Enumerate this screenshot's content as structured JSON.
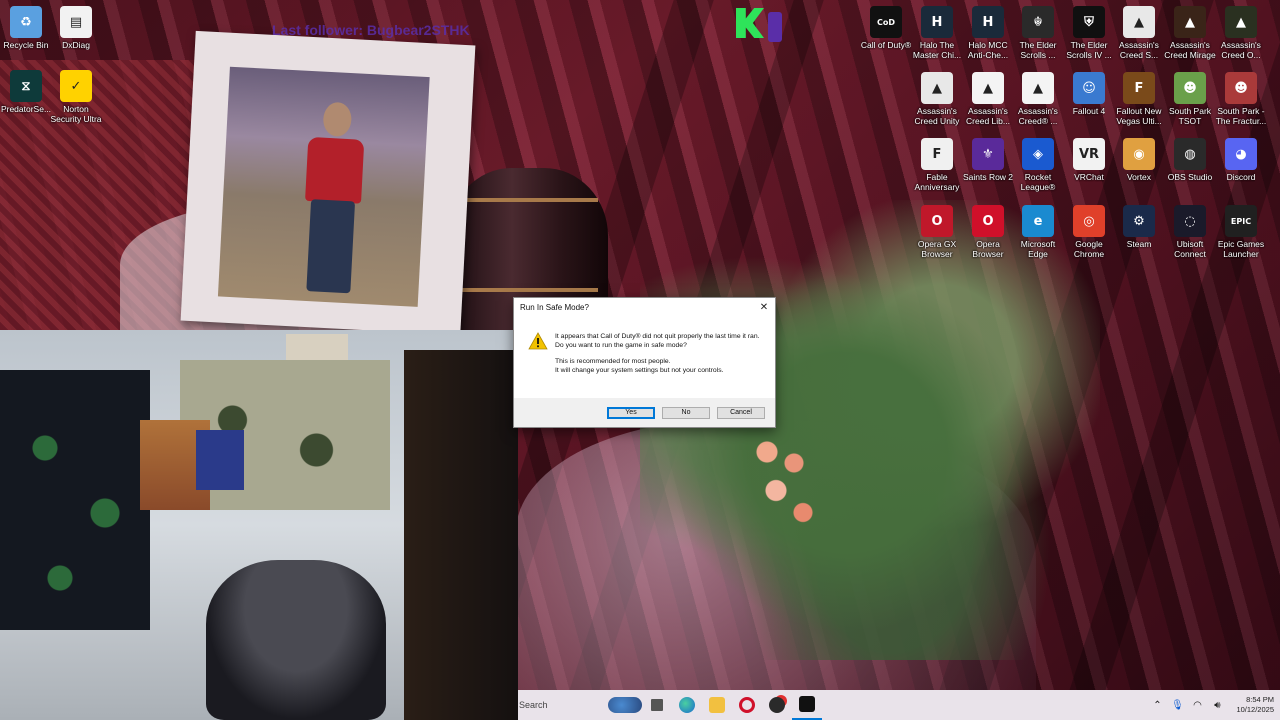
{
  "overlay": {
    "stream_text": "Last follower: Bugbear2STHK"
  },
  "desktop_icons": [
    {
      "label": "Recycle Bin",
      "name": "recycle-bin-icon",
      "glyph": "♻",
      "bg": "#5aa0e0"
    },
    {
      "label": "DxDiag",
      "name": "dxdiag-icon",
      "glyph": "▤",
      "bg": "#f2f2f2"
    },
    {
      "label": "PredatorSe...",
      "name": "predatorsense-icon",
      "glyph": "⧖",
      "bg": "#0e3a3a"
    },
    {
      "label": "Norton Security Ultra",
      "name": "norton-icon",
      "glyph": "✓",
      "bg": "#ffd200"
    },
    {
      "label": "Call of Duty®",
      "name": "call-of-duty-icon",
      "glyph": "CoD",
      "bg": "#111111"
    },
    {
      "label": "Halo The Master Chi...",
      "name": "halo-mcc-icon",
      "glyph": "H",
      "bg": "#1a2a3a"
    },
    {
      "label": "Halo MCC Anti-Che...",
      "name": "halo-anticheat-icon",
      "glyph": "H",
      "bg": "#1a2a3a"
    },
    {
      "label": "The Elder Scrolls ...",
      "name": "elder-scrolls-v-icon",
      "glyph": "☬",
      "bg": "#2a2a2a"
    },
    {
      "label": "The Elder Scrolls IV ...",
      "name": "elder-scrolls-iv-icon",
      "glyph": "⛨",
      "bg": "#101010"
    },
    {
      "label": "Assassin's Creed S...",
      "name": "ac-syndicate-icon",
      "glyph": "▲",
      "bg": "#e8e8e8"
    },
    {
      "label": "Assassin's Creed Mirage",
      "name": "ac-mirage-icon",
      "glyph": "▲",
      "bg": "#3a2418"
    },
    {
      "label": "Assassin's Creed O...",
      "name": "ac-origins-icon",
      "glyph": "▲",
      "bg": "#2a3020"
    },
    {
      "label": "Assassin's Creed Unity",
      "name": "ac-unity-icon",
      "glyph": "▲",
      "bg": "#e8e8e8"
    },
    {
      "label": "Assassin's Creed Lib...",
      "name": "ac-liberation-icon",
      "glyph": "▲",
      "bg": "#f4f4f4"
    },
    {
      "label": "Assassin's Creed® ...",
      "name": "ac-other-icon",
      "glyph": "▲",
      "bg": "#f4f4f4"
    },
    {
      "label": "Fallout 4",
      "name": "fallout-4-icon",
      "glyph": "☺",
      "bg": "#3a7ad0"
    },
    {
      "label": "Fallout New Vegas Ulti...",
      "name": "fallout-nv-icon",
      "glyph": "F",
      "bg": "#7a4a1a"
    },
    {
      "label": "South Park TSOT",
      "name": "south-park-tsot-icon",
      "glyph": "☻",
      "bg": "#6aa04a"
    },
    {
      "label": "South Park - The Fractur...",
      "name": "south-park-fbw-icon",
      "glyph": "☻",
      "bg": "#aa3a3a"
    },
    {
      "label": "Fable Anniversary",
      "name": "fable-icon",
      "glyph": "F",
      "bg": "#f0f0f0"
    },
    {
      "label": "Saints Row 2",
      "name": "saints-row-2-icon",
      "glyph": "⚜",
      "bg": "#5a2a9a"
    },
    {
      "label": "Rocket League®",
      "name": "rocket-league-icon",
      "glyph": "◈",
      "bg": "#1a5ad0"
    },
    {
      "label": "VRChat",
      "name": "vrchat-icon",
      "glyph": "VR",
      "bg": "#f2f2f2"
    },
    {
      "label": "Vortex",
      "name": "vortex-icon",
      "glyph": "◉",
      "bg": "#e0a040"
    },
    {
      "label": "OBS Studio",
      "name": "obs-studio-icon",
      "glyph": "◍",
      "bg": "#2a2a2a"
    },
    {
      "label": "Discord",
      "name": "discord-icon",
      "glyph": "◕",
      "bg": "#5865f2"
    },
    {
      "label": "Opera GX Browser",
      "name": "opera-gx-icon",
      "glyph": "O",
      "bg": "#c0182a"
    },
    {
      "label": "Opera Browser",
      "name": "opera-icon",
      "glyph": "O",
      "bg": "#d0102a"
    },
    {
      "label": "Microsoft Edge",
      "name": "microsoft-edge-icon",
      "glyph": "e",
      "bg": "#1a8ad0"
    },
    {
      "label": "Google Chrome",
      "name": "google-chrome-icon",
      "glyph": "◎",
      "bg": "#e0402a"
    },
    {
      "label": "Steam",
      "name": "steam-icon",
      "glyph": "⚙",
      "bg": "#1a2a4a"
    },
    {
      "label": "Ubisoft Connect",
      "name": "ubisoft-connect-icon",
      "glyph": "◌",
      "bg": "#1a1a2a"
    },
    {
      "label": "Epic Games Launcher",
      "name": "epic-games-icon",
      "glyph": "EPIC",
      "bg": "#202020"
    }
  ],
  "dialog": {
    "title": "Run In Safe Mode?",
    "line1": "It appears that Call of Duty® did not quit properly the last time it ran.",
    "line2": "Do you want to run the game in safe mode?",
    "line3": "This is recommended for most people.",
    "line4": "It will change your system settings but not your controls.",
    "yes": "Yes",
    "no": "No",
    "cancel": "Cancel"
  },
  "taskbar": {
    "search_placeholder": "Search",
    "time": "8:54 PM",
    "date": "10/12/2025"
  },
  "colors": {
    "dialog_default_border": "#0078d7",
    "warning": "#f2c200",
    "kick_green": "#2ee45a"
  }
}
